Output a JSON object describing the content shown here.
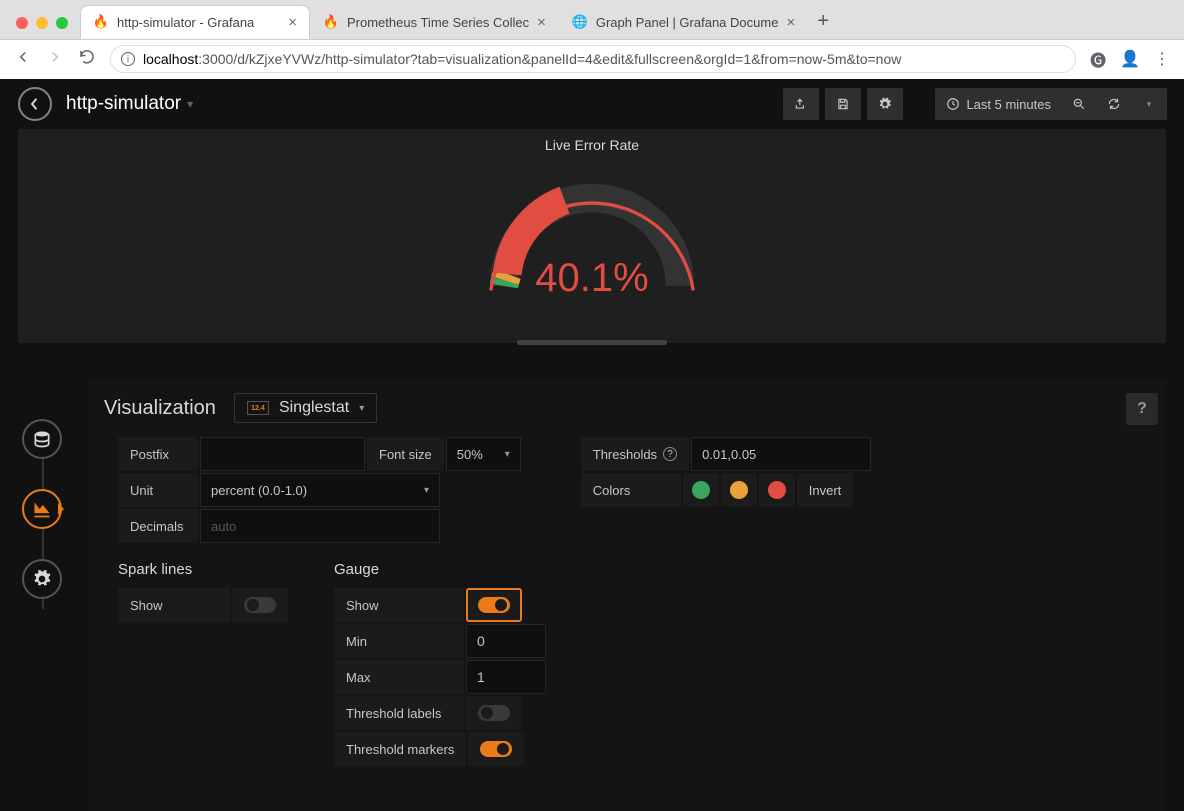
{
  "browser": {
    "tabs": [
      {
        "title": "http-simulator - Grafana",
        "active": true
      },
      {
        "title": "Prometheus Time Series Collec",
        "active": false
      },
      {
        "title": "Graph Panel | Grafana Docume",
        "active": false
      }
    ],
    "url_host": "localhost",
    "url_rest": ":3000/d/kZjxeYVWz/http-simulator?tab=visualization&panelId=4&edit&fullscreen&orgId=1&from=now-5m&to=now"
  },
  "header": {
    "dashboard_name": "http-simulator",
    "time_range": "Last 5 minutes"
  },
  "panel": {
    "title": "Live Error Rate",
    "value_display": "40.1%"
  },
  "editor": {
    "tab_title": "Visualization",
    "viz_name": "Singlestat",
    "viz_badge": "12.4",
    "postfix_label": "Postfix",
    "postfix_value": "",
    "fontsize_label": "Font size",
    "fontsize_value": "50%",
    "unit_label": "Unit",
    "unit_value": "percent (0.0-1.0)",
    "decimals_label": "Decimals",
    "decimals_placeholder": "auto",
    "thresholds_label": "Thresholds",
    "thresholds_value": "0.01,0.05",
    "colors_label": "Colors",
    "invert_label": "Invert",
    "color_values": [
      "#3ba55d",
      "#e9a23b",
      "#e24d42"
    ],
    "sparklines_title": "Spark lines",
    "show_label": "Show",
    "gauge_title": "Gauge",
    "gauge_show_label": "Show",
    "gauge_min_label": "Min",
    "gauge_min_value": "0",
    "gauge_max_label": "Max",
    "gauge_max_value": "1",
    "threshold_labels_label": "Threshold labels",
    "threshold_markers_label": "Threshold markers"
  },
  "chart_data": {
    "type": "gauge",
    "value": 0.401,
    "min": 0,
    "max": 1,
    "thresholds": [
      0.01,
      0.05
    ],
    "threshold_colors": [
      "#3ba55d",
      "#e9a23b",
      "#e24d42"
    ],
    "display_unit": "percent (0.0-1.0)",
    "title": "Live Error Rate"
  }
}
